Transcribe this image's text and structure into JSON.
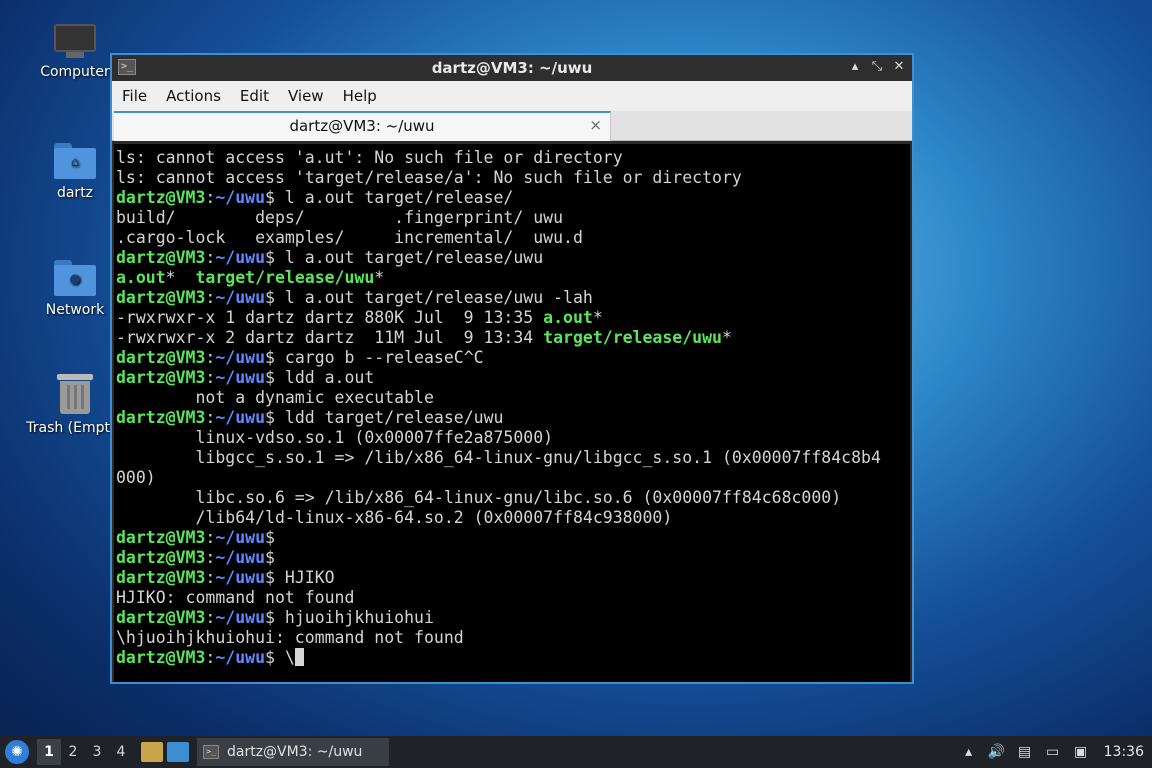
{
  "desktop": {
    "icons": [
      {
        "label": "Computer",
        "icon": "computer-icon"
      },
      {
        "label": "dartz",
        "icon": "home-folder-icon"
      },
      {
        "label": "Network",
        "icon": "network-folder-icon"
      },
      {
        "label": "Trash (Empty)",
        "icon": "trash-icon"
      }
    ]
  },
  "window": {
    "title": "dartz@VM3: ~/uwu",
    "menus": [
      "File",
      "Actions",
      "Edit",
      "View",
      "Help"
    ],
    "tab_title": "dartz@VM3: ~/uwu",
    "tab_close": "×",
    "controls": {
      "minimize": "▴",
      "maximize": "⤡",
      "close": "✕"
    }
  },
  "terminal": {
    "user": "dartz@VM3",
    "colon": ":",
    "path": "~/uwu",
    "prompt_sym": "$",
    "lines": {
      "l1": "ls: cannot access 'a.ut': No such file or directory",
      "l2": "ls: cannot access 'target/release/a': No such file or directory",
      "c3": " l a.out target/release/",
      "l4": "build/        deps/         .fingerprint/ uwu",
      "l5": ".cargo-lock   examples/     incremental/  uwu.d",
      "c6": " l a.out target/release/uwu",
      "l7a": "a.out",
      "l7b": "*  ",
      "l7c": "target/release/uwu",
      "l7d": "*",
      "c8": " l a.out target/release/uwu -lah",
      "l9a": "-rwxrwxr-x 1 dartz dartz 880K Jul  9 13:35 ",
      "l9b": "a.out",
      "l9c": "*",
      "l10a": "-rwxrwxr-x 2 dartz dartz  11M Jul  9 13:34 ",
      "l10b": "target/release/uwu",
      "l10c": "*",
      "c11": " cargo b --releaseC^C",
      "c12": " ldd a.out",
      "l13": "        not a dynamic executable",
      "c14": " ldd target/release/uwu",
      "l15": "        linux-vdso.so.1 (0x00007ffe2a875000)",
      "l16": "        libgcc_s.so.1 => /lib/x86_64-linux-gnu/libgcc_s.so.1 (0x00007ff84c8b4",
      "l17": "000)",
      "l18": "        libc.so.6 => /lib/x86_64-linux-gnu/libc.so.6 (0x00007ff84c68c000)",
      "l19": "        /lib64/ld-linux-x86-64.so.2 (0x00007ff84c938000)",
      "c20": "",
      "c21": "",
      "c22": " HJIKO",
      "l23": "HJIKO: command not found",
      "c24": " hjuoihjkhuiohui",
      "l25": "\\hjuoihjkhuiohui: command not found",
      "c26": " \\"
    }
  },
  "taskbar": {
    "workspaces": [
      "1",
      "2",
      "3",
      "4"
    ],
    "task_label": "dartz@VM3: ~/uwu",
    "clock": "13:36"
  }
}
